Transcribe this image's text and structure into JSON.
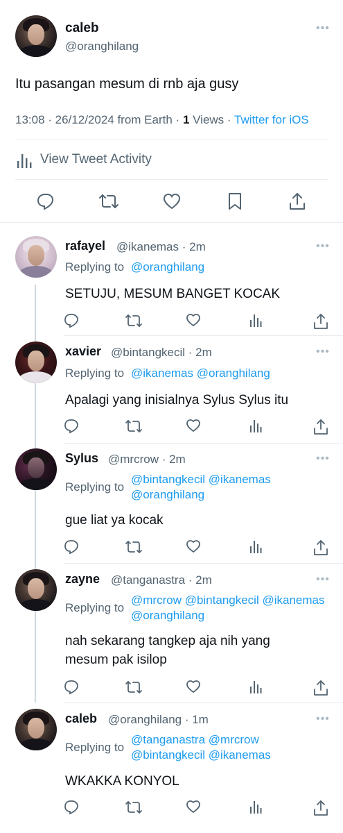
{
  "main_tweet": {
    "name": "caleb",
    "handle": "@oranghilang",
    "more": "•••",
    "text": "Itu pasangan mesum di rnb aja gusy",
    "meta": {
      "time_date": "13:08 · 26/12/2024 from Earth ·",
      "views_count": "1",
      "views_label": "Views",
      "sep": "·",
      "client": "Twitter for iOS"
    },
    "activity_label": "View Tweet Activity"
  },
  "replies": [
    {
      "name": "rafayel",
      "handle_time": "@ikanemas · 2m",
      "replying_label": "Replying to",
      "mentions_line1": "@oranghilang",
      "mentions_line2": "",
      "text_line1": "SETUJU, MESUM BANGET KOCAK",
      "text_line2": ""
    },
    {
      "name": "xavier",
      "handle_time": "@bintangkecil · 2m",
      "replying_label": "Replying to",
      "mentions_line1": "@ikanemas @oranghilang",
      "mentions_line2": "",
      "text_line1": "Apalagi yang inisialnya Sylus Sylus itu",
      "text_line2": ""
    },
    {
      "name": "Sylus",
      "handle_time": "@mrcrow · 2m",
      "replying_label": "Replying to",
      "mentions_line1": "@bintangkecil @ikanemas",
      "mentions_line2": "@oranghilang",
      "text_line1": "gue liat ya kocak",
      "text_line2": ""
    },
    {
      "name": "zayne",
      "handle_time": "@tanganastra · 2m",
      "replying_label": "Replying to",
      "mentions_line1": "@mrcrow @bintangkecil @ikanemas",
      "mentions_line2": "@oranghilang",
      "text_line1": "nah sekarang tangkep aja nih yang",
      "text_line2": "mesum pak isilop"
    },
    {
      "name": "caleb",
      "handle_time": "@oranghilang · 1m",
      "replying_label": "Replying to",
      "mentions_line1": "@tanganastra @mrcrow",
      "mentions_line2": "@bintangkecil @ikanemas",
      "text_line1": "WKAKKA KONYOL",
      "text_line2": ""
    }
  ],
  "colors": {
    "accent": "#1d9bf0",
    "secondary_text": "#536471",
    "icon": "#536471",
    "divider": "#e6ecf0"
  },
  "icons": [
    "reply-icon",
    "retweet-icon",
    "like-icon",
    "bookmark-icon",
    "share-icon",
    "analytics-icon",
    "more-icon"
  ]
}
